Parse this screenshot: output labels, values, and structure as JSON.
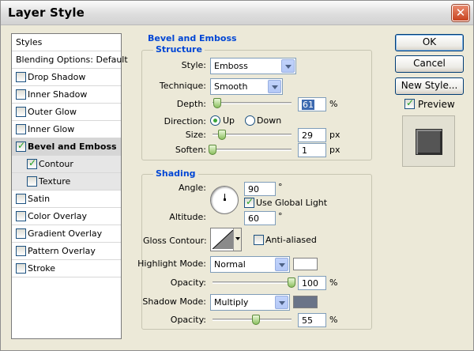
{
  "window": {
    "title": "Layer Style"
  },
  "styles_list": {
    "header": "Styles",
    "items": [
      {
        "label": "Blending Options: Default",
        "checkbox": false,
        "checked": false,
        "selected": false,
        "sub": false
      },
      {
        "label": "Drop Shadow",
        "checkbox": true,
        "checked": false,
        "selected": false,
        "sub": false
      },
      {
        "label": "Inner Shadow",
        "checkbox": true,
        "checked": false,
        "selected": false,
        "sub": false
      },
      {
        "label": "Outer Glow",
        "checkbox": true,
        "checked": false,
        "selected": false,
        "sub": false
      },
      {
        "label": "Inner Glow",
        "checkbox": true,
        "checked": false,
        "selected": false,
        "sub": false
      },
      {
        "label": "Bevel and Emboss",
        "checkbox": true,
        "checked": true,
        "selected": true,
        "sub": false
      },
      {
        "label": "Contour",
        "checkbox": true,
        "checked": true,
        "selected": false,
        "sub": true
      },
      {
        "label": "Texture",
        "checkbox": true,
        "checked": false,
        "selected": false,
        "sub": true
      },
      {
        "label": "Satin",
        "checkbox": true,
        "checked": false,
        "selected": false,
        "sub": false
      },
      {
        "label": "Color Overlay",
        "checkbox": true,
        "checked": false,
        "selected": false,
        "sub": false
      },
      {
        "label": "Gradient Overlay",
        "checkbox": true,
        "checked": false,
        "selected": false,
        "sub": false
      },
      {
        "label": "Pattern Overlay",
        "checkbox": true,
        "checked": false,
        "selected": false,
        "sub": false
      },
      {
        "label": "Stroke",
        "checkbox": true,
        "checked": false,
        "selected": false,
        "sub": false
      }
    ]
  },
  "bevel": {
    "section_title": "Bevel and Emboss",
    "structure_title": "Structure",
    "style_label": "Style:",
    "style_value": "Emboss",
    "technique_label": "Technique:",
    "technique_value": "Smooth",
    "depth_label": "Depth:",
    "depth_value": "61",
    "depth_unit": "%",
    "depth_fraction": 0.061,
    "direction_label": "Direction:",
    "direction_up": "Up",
    "direction_down": "Down",
    "direction_selected": "Up",
    "size_label": "Size:",
    "size_value": "29",
    "size_unit": "px",
    "size_fraction": 0.116,
    "soften_label": "Soften:",
    "soften_value": "1",
    "soften_unit": "px",
    "soften_fraction": 0.0
  },
  "shading": {
    "title": "Shading",
    "angle_label": "Angle:",
    "angle_value": "90",
    "angle_unit": "°",
    "use_global_light_label": "Use Global Light",
    "use_global_light_checked": true,
    "altitude_label": "Altitude:",
    "altitude_value": "60",
    "altitude_unit": "°",
    "gloss_contour_label": "Gloss Contour:",
    "anti_aliased_label": "Anti-aliased",
    "anti_aliased_checked": false,
    "highlight_mode_label": "Highlight Mode:",
    "highlight_mode_value": "Normal",
    "highlight_color": "#ffffff",
    "opacity_label": "Opacity:",
    "highlight_opacity_value": "100",
    "highlight_opacity_fraction": 1.0,
    "opacity_unit": "%",
    "shadow_mode_label": "Shadow Mode:",
    "shadow_mode_value": "Multiply",
    "shadow_color": "#6a7488",
    "shadow_opacity_value": "55",
    "shadow_opacity_fraction": 0.55
  },
  "buttons": {
    "ok": "OK",
    "cancel": "Cancel",
    "new_style": "New Style...",
    "preview_label": "Preview",
    "preview_checked": true
  },
  "icons": {
    "close": "close-icon",
    "check": "checkmark-icon",
    "dial": "angle-dial-icon",
    "contour": "contour-curve-icon"
  }
}
